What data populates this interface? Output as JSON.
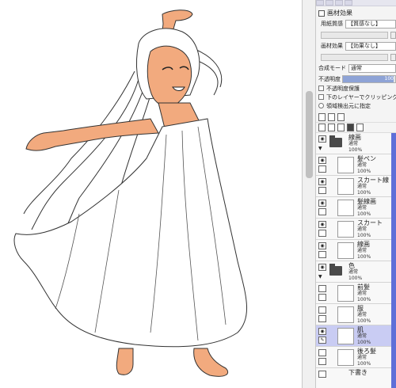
{
  "panel": {
    "texture_section_title": "画材効果",
    "paper_texture_label": "用紙質感",
    "paper_texture_value": "【質感なし】",
    "material_label": "画材効果",
    "material_value": "【効果なし】",
    "blend_mode_label": "合成モード",
    "blend_mode_value": "通常",
    "opacity_label": "不透明度",
    "opacity_value": "100",
    "protect_opacity_label": "不透明度保護",
    "clip_below_label": "下のレイヤーでクリッピング",
    "selection_source_label": "領域検出元に指定"
  },
  "layers": [
    {
      "name": "線画",
      "mode": "通常",
      "opacity": "100%",
      "type": "folder"
    },
    {
      "name": "髪ペン",
      "mode": "通常",
      "opacity": "100%",
      "type": "layer",
      "indent": true
    },
    {
      "name": "スカート線",
      "mode": "通常",
      "opacity": "100%",
      "type": "layer",
      "indent": true
    },
    {
      "name": "髪線画",
      "mode": "通常",
      "opacity": "100%",
      "type": "layer",
      "indent": true
    },
    {
      "name": "スカート",
      "mode": "通常",
      "opacity": "100%",
      "type": "layer",
      "indent": true
    },
    {
      "name": "線画",
      "mode": "通常",
      "opacity": "100%",
      "type": "layer",
      "indent": true
    },
    {
      "name": "色",
      "mode": "通常",
      "opacity": "100%",
      "type": "folder"
    },
    {
      "name": "前髪",
      "mode": "通常",
      "opacity": "100%",
      "type": "layer",
      "indent": true
    },
    {
      "name": "服",
      "mode": "通常",
      "opacity": "100%",
      "type": "layer",
      "indent": true
    },
    {
      "name": "肌",
      "mode": "通常",
      "opacity": "100%",
      "type": "layer",
      "indent": true,
      "selected": true
    },
    {
      "name": "後ろ髪",
      "mode": "通常",
      "opacity": "100%",
      "type": "layer",
      "indent": true
    },
    {
      "name": "下書き",
      "mode": "",
      "opacity": "",
      "type": "folder"
    }
  ],
  "colors": {
    "skin": "#f2aa7e",
    "selection": "#c9ccf3",
    "accent": "#5f6fd8"
  }
}
